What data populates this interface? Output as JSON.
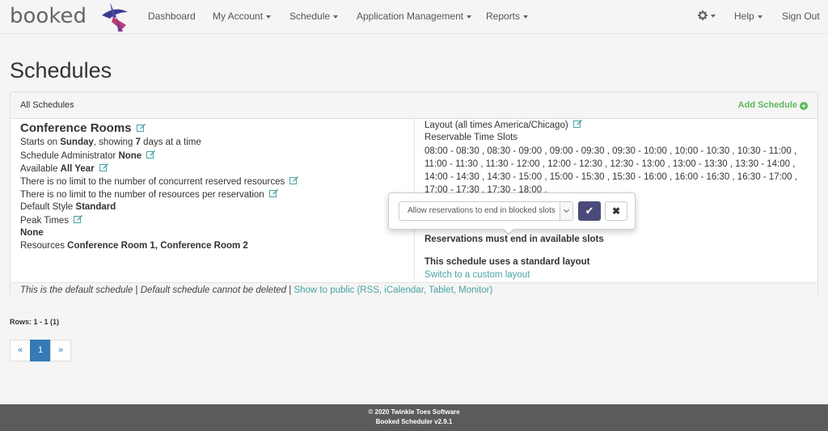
{
  "app": {
    "logo_text": "booked"
  },
  "nav": {
    "dashboard": "Dashboard",
    "my_account": "My Account",
    "schedule": "Schedule",
    "application_management": "Application Management",
    "reports": "Reports",
    "settings_icon": "gear-icon",
    "help": "Help",
    "sign_out": "Sign Out"
  },
  "page": {
    "title": "Schedules"
  },
  "panel": {
    "heading": "All Schedules",
    "add_schedule": "Add Schedule"
  },
  "schedule": {
    "name": "Conference Rooms",
    "starts_prefix": "Starts on ",
    "start_day": "Sunday",
    "showing_prefix": ", showing ",
    "days_shown": "7",
    "days_suffix": " days at a time",
    "admin_label": "Schedule Administrator ",
    "admin_value": "None",
    "available_label": "Available ",
    "available_value": "All Year",
    "concurrent_limit": "There is no limit to the number of concurrent reserved resources",
    "resources_limit": "There is no limit to the number of resources per reservation",
    "default_style_label": "Default Style ",
    "default_style_value": "Standard",
    "peak_times_label": "Peak Times",
    "peak_times_value": "None",
    "resources_label": "Resources ",
    "resources_value": "Conference Room 1, Conference Room 2",
    "layout_label": "Layout (all times America/Chicago)",
    "reservable_slots_label": "Reservable Time Slots",
    "slot_rows": [
      "08:00 - 08:30 , 08:30 - 09:00 , 09:00 - 09:30 , 09:30 - 10:00 , 10:00 - 10:30 , 10:30 - 11:00 ,",
      "11:00 - 11:30 , 11:30 - 12:00 , 12:00 - 12:30 , 12:30 - 13:00 , 13:00 - 13:30 , 13:30 - 14:00 ,",
      "14:00 - 14:30 , 14:30 - 15:00 , 15:00 - 15:30 , 15:30 - 16:00 , 16:00 - 16:30 , 16:30 - 17:00 ,",
      "17:00 - 17:30 , 17:30 - 18:00 ,"
    ],
    "reservations_rule": "Reservations must end in available slots",
    "layout_type": "This schedule uses a standard layout",
    "switch_layout": "Switch to a custom layout"
  },
  "panel_footer": {
    "default_text": "This is the default schedule",
    "separator": " | ",
    "cannot_delete": "Default schedule cannot be deleted",
    "separator2": " | ",
    "show_public": "Show to public (RSS, iCalendar, Tablet, Monitor)"
  },
  "popover": {
    "select_value": "Allow reservations to end in blocked slots",
    "ok_glyph": "✔",
    "cancel_glyph": "✖"
  },
  "rows_info": "Rows: 1 - 1 (1)",
  "pagination": {
    "prev": "«",
    "current": "1",
    "next": "»"
  },
  "footer": {
    "copyright": "© 2020 Twinkle Toes Software",
    "version": "Booked Scheduler v2.9.1"
  },
  "colors": {
    "link": "#4aa3a3",
    "add": "#5cb85c",
    "page_active": "#337ab7",
    "ok_button": "#4a4a7a"
  }
}
